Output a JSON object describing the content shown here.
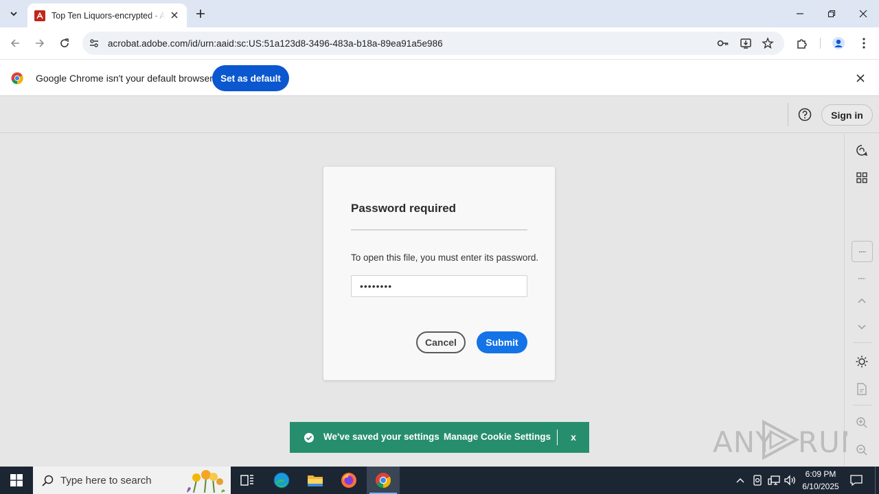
{
  "browser": {
    "tab": {
      "title": "Top Ten Liquors-encrypted - Adobe Acrobat",
      "favicon": "acrobat-icon"
    },
    "url": "acrobat.adobe.com/id/urn:aaid:sc:US:51a123d8-3496-483a-b18a-89ea91a5e986",
    "infobar": {
      "message": "Google Chrome isn't your default browser",
      "button_label": "Set as default"
    },
    "colors": {
      "tabstrip": "#dfe6f3",
      "accent": "#0b57d0"
    }
  },
  "acrobat": {
    "header": {
      "sign_in_label": "Sign in"
    },
    "dialog": {
      "title": "Password required",
      "message": "To open this file, you must enter its password.",
      "password_value": "••••••••",
      "cancel_label": "Cancel",
      "submit_label": "Submit"
    },
    "toast": {
      "message": "We've saved your settings",
      "link_label": "Manage Cookie Settings",
      "close_label": "x",
      "color": "#268e6c"
    },
    "rail_icons": [
      "ai-assistant-icon",
      "grid-icon",
      "fit-page-icon",
      "minus-icon",
      "chevron-up-icon",
      "chevron-down-icon",
      "theme-icon",
      "page-icon",
      "zoom-in-icon",
      "zoom-out-icon"
    ]
  },
  "watermark": {
    "text": "ANY RUN"
  },
  "taskbar": {
    "search_placeholder": "Type here to search",
    "apps": [
      "task-view-icon",
      "edge-icon",
      "file-explorer-icon",
      "firefox-icon",
      "chrome-icon"
    ],
    "clock_time": "6:09 PM",
    "clock_date": "6/10/2025"
  }
}
